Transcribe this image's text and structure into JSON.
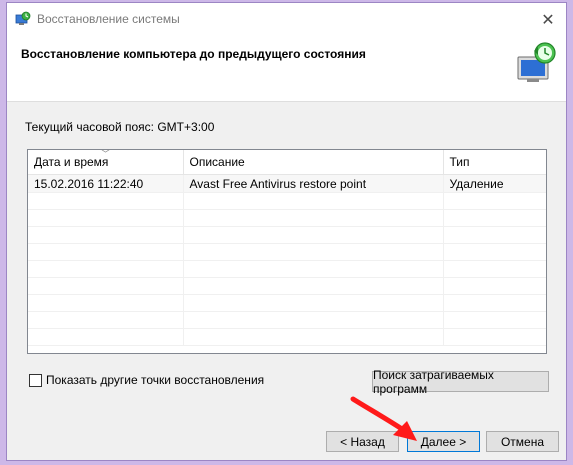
{
  "window": {
    "title": "Восстановление системы",
    "close_icon": "close-icon"
  },
  "header": {
    "title": "Восстановление компьютера до предыдущего состояния",
    "icon": "system-restore-icon"
  },
  "timezone_text": "Текущий часовой пояс: GMT+3:00",
  "table": {
    "columns": [
      "Дата и время",
      "Описание",
      "Тип"
    ],
    "rows": [
      [
        "15.02.2016 11:22:40",
        "Avast Free Antivirus restore point",
        "Удаление"
      ]
    ]
  },
  "checkbox": {
    "label": "Показать другие точки восстановления",
    "checked": false
  },
  "buttons": {
    "affected": "Поиск затрагиваемых программ",
    "back": "< Назад",
    "next": "Далее >",
    "cancel": "Отмена"
  },
  "colors": {
    "annotation_arrow": "#ff1a1a",
    "focus_border": "#0078d7"
  }
}
